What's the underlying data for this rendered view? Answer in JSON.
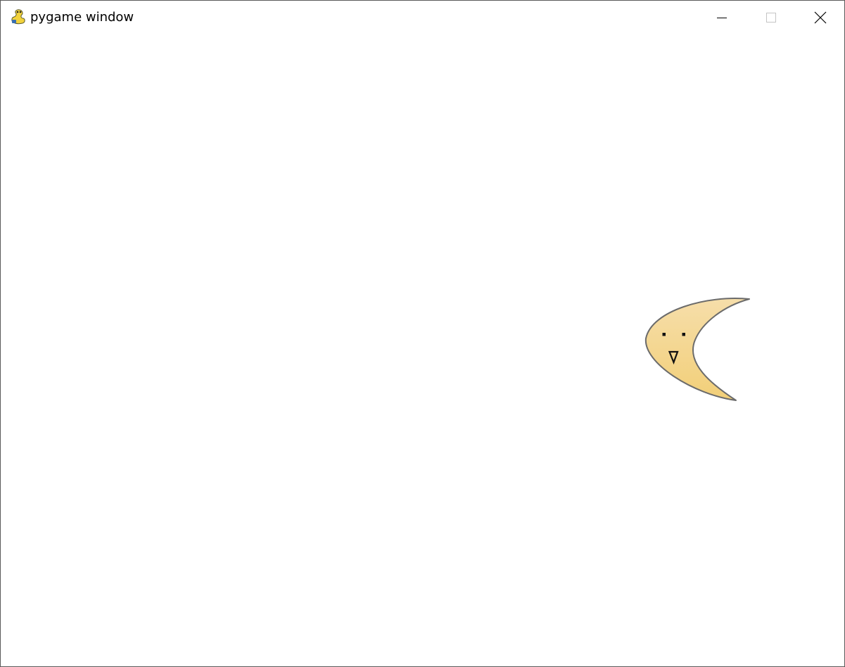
{
  "window": {
    "title": "pygame window",
    "app_icon": "pygame-snake-icon",
    "controls": {
      "minimize_icon": "minimize-icon",
      "maximize_icon": "maximize-icon",
      "close_icon": "close-icon"
    }
  },
  "game": {
    "background_color": "#ffffff",
    "sprite": {
      "kind": "crescent-moon-face",
      "fill_top": "#f6deaa",
      "fill_bottom": "#f2cf78",
      "outline_color": "#6b6b6b"
    }
  }
}
